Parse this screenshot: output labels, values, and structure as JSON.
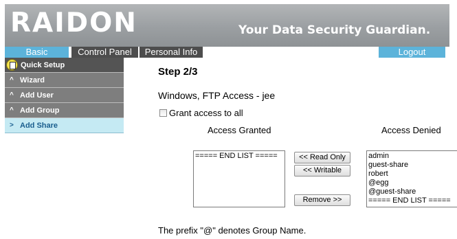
{
  "header": {
    "logo": "RAIDON",
    "tagline": "Your Data Security Guardian."
  },
  "tabs": {
    "basic": "Basic",
    "control_panel": "Control Panel",
    "personal_info": "Personal Info",
    "logout": "Logout"
  },
  "sidebar": {
    "quick_setup": "Quick Setup",
    "items": [
      {
        "chevron": "^",
        "label": "Wizard"
      },
      {
        "chevron": "^",
        "label": "Add User"
      },
      {
        "chevron": "^",
        "label": "Add Group"
      },
      {
        "chevron": ">",
        "label": "Add Share"
      }
    ]
  },
  "main": {
    "step": "Step 2/3",
    "heading": "Windows, FTP Access - jee",
    "grant_all_label": "Grant access to all",
    "grant_all_checked": false,
    "granted_heading": "Access Granted",
    "denied_heading": "Access Denied",
    "granted_list": [
      "===== END LIST ====="
    ],
    "denied_list": [
      "admin",
      "guest-share",
      "robert",
      "@egg",
      "@guest-share",
      "===== END LIST ====="
    ],
    "buttons": {
      "read_only": "<< Read Only",
      "writable": "<< Writable",
      "remove": "Remove >>"
    },
    "prefix_note": "The prefix \"@\" denotes Group Name."
  },
  "colors": {
    "accent_tab": "#5cb3da",
    "dark_tab": "#4d4d4d",
    "sidebar_active_bg": "#c5eaf3"
  }
}
